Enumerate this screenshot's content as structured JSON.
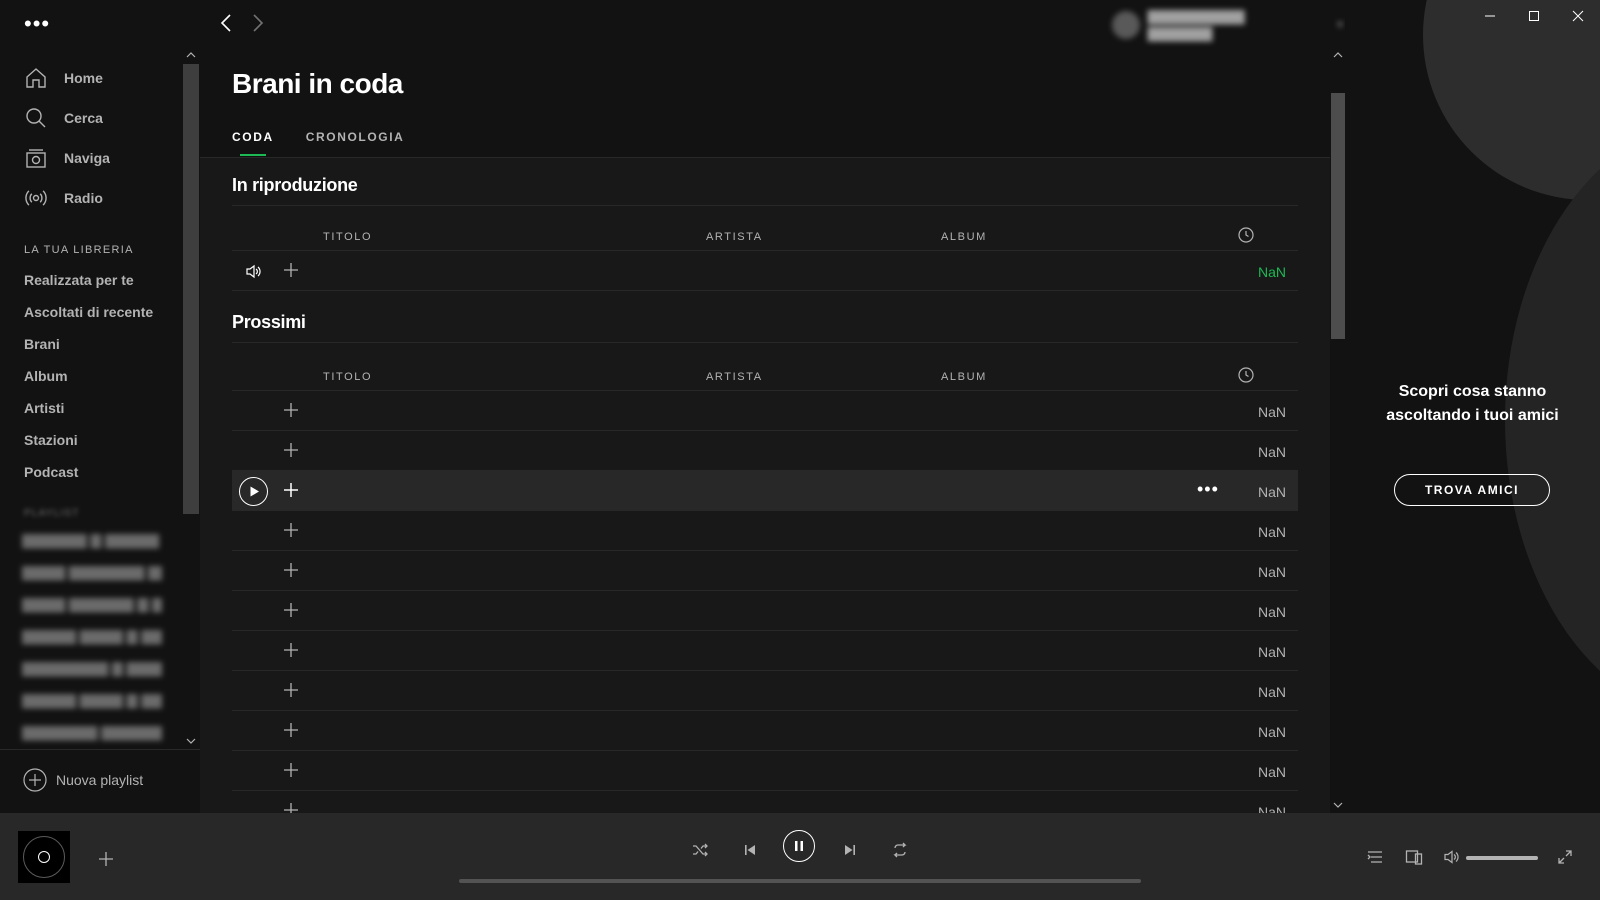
{
  "sidebar": {
    "nav": [
      {
        "label": "Home",
        "icon": "home-icon"
      },
      {
        "label": "Cerca",
        "icon": "search-icon"
      },
      {
        "label": "Naviga",
        "icon": "browse-icon"
      },
      {
        "label": "Radio",
        "icon": "radio-icon"
      }
    ],
    "library_title": "LA TUA LIBRERIA",
    "library": [
      "Realizzata per te",
      "Ascoltati di recente",
      "Brani",
      "Album",
      "Artisti",
      "Stazioni",
      "Podcast"
    ],
    "new_playlist": "Nuova playlist"
  },
  "header": {
    "title": "Brani in coda",
    "tabs": [
      {
        "label": "CODA",
        "active": true
      },
      {
        "label": "CRONOLOGIA",
        "active": false
      }
    ]
  },
  "now_playing": {
    "title": "In riproduzione",
    "columns": {
      "title": "TITOLO",
      "artist": "ARTISTA",
      "album": "ALBUM"
    },
    "track": {
      "duration": "NaN"
    }
  },
  "next_up": {
    "title": "Prossimi",
    "columns": {
      "title": "TITOLO",
      "artist": "ARTISTA",
      "album": "ALBUM"
    },
    "tracks": [
      {
        "duration": "NaN"
      },
      {
        "duration": "NaN"
      },
      {
        "duration": "NaN"
      },
      {
        "duration": "NaN"
      },
      {
        "duration": "NaN"
      },
      {
        "duration": "NaN"
      },
      {
        "duration": "NaN"
      },
      {
        "duration": "NaN"
      },
      {
        "duration": "NaN"
      },
      {
        "duration": "NaN"
      },
      {
        "duration": "NaN"
      }
    ]
  },
  "friends": {
    "line1": "Scopri cosa stanno",
    "line2": "ascoltando i tuoi amici",
    "button": "TROVA AMICI"
  },
  "player": {
    "progress": 0,
    "volume": 1.0
  },
  "colors": {
    "accent": "#1db954",
    "background": "#121212",
    "panel": "#181818",
    "bar": "#282828"
  }
}
